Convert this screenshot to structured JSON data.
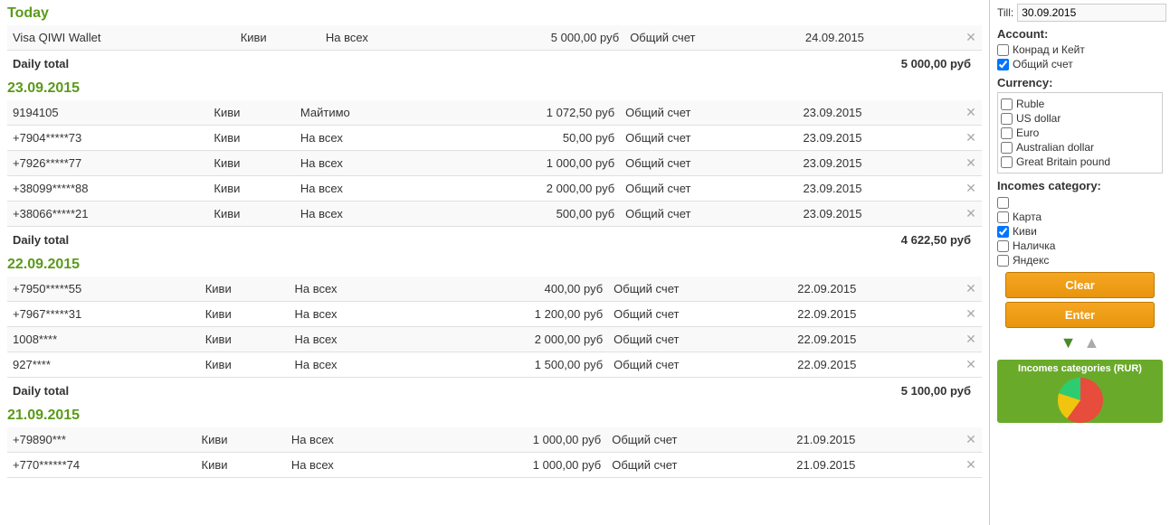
{
  "sidebar": {
    "till_label": "Till:",
    "till_date": "30.09.2015",
    "account_label": "Account:",
    "accounts": [
      {
        "id": "acc1",
        "label": "Конрад и Кейт",
        "checked": false
      },
      {
        "id": "acc2",
        "label": "Общий счет",
        "checked": true
      }
    ],
    "currency_label": "Currency:",
    "currencies": [
      {
        "id": "cur1",
        "label": "Ruble",
        "checked": false
      },
      {
        "id": "cur2",
        "label": "US dollar",
        "checked": false
      },
      {
        "id": "cur3",
        "label": "Euro",
        "checked": false
      },
      {
        "id": "cur4",
        "label": "Australian dollar",
        "checked": false
      },
      {
        "id": "cur5",
        "label": "Great Britain pound",
        "checked": false
      }
    ],
    "incomes_category_label": "Incomes category:",
    "incomes_categories": [
      {
        "id": "ic0",
        "label": "",
        "checked": false
      },
      {
        "id": "ic1",
        "label": "Карта",
        "checked": false
      },
      {
        "id": "ic2",
        "label": "Киви",
        "checked": true
      },
      {
        "id": "ic3",
        "label": "Наличка",
        "checked": false
      },
      {
        "id": "ic4",
        "label": "Яндекс",
        "checked": false
      }
    ],
    "btn_clear": "Clear",
    "btn_enter": "Enter",
    "chart_title": "Incomes categories (RUR)"
  },
  "sections": [
    {
      "date": "Today",
      "rows": [
        {
          "col1": "Visa QIWI Wallet",
          "col2": "Киви",
          "col3": "На всех",
          "amount": "5 000,00 руб",
          "account": "Общий счет",
          "date": "24.09.2015"
        }
      ],
      "daily_total_label": "Daily total",
      "daily_total_amount": "5 000,00 руб"
    },
    {
      "date": "23.09.2015",
      "rows": [
        {
          "col1": "9194105",
          "col2": "Киви",
          "col3": "Майтимо",
          "amount": "1 072,50 руб",
          "account": "Общий счет",
          "date": "23.09.2015"
        },
        {
          "col1": "+7904*****73",
          "col2": "Киви",
          "col3": "На всех",
          "amount": "50,00 руб",
          "account": "Общий счет",
          "date": "23.09.2015"
        },
        {
          "col1": "+7926*****77",
          "col2": "Киви",
          "col3": "На всех",
          "amount": "1 000,00 руб",
          "account": "Общий счет",
          "date": "23.09.2015"
        },
        {
          "col1": "+38099*****88",
          "col2": "Киви",
          "col3": "На всех",
          "amount": "2 000,00 руб",
          "account": "Общий счет",
          "date": "23.09.2015"
        },
        {
          "col1": "+38066*****21",
          "col2": "Киви",
          "col3": "На всех",
          "amount": "500,00 руб",
          "account": "Общий счет",
          "date": "23.09.2015"
        }
      ],
      "daily_total_label": "Daily total",
      "daily_total_amount": "4 622,50 руб"
    },
    {
      "date": "22.09.2015",
      "rows": [
        {
          "col1": "+7950*****55",
          "col2": "Киви",
          "col3": "На всех",
          "amount": "400,00 руб",
          "account": "Общий счет",
          "date": "22.09.2015"
        },
        {
          "col1": "+7967*****31",
          "col2": "Киви",
          "col3": "На всех",
          "amount": "1 200,00 руб",
          "account": "Общий счет",
          "date": "22.09.2015"
        },
        {
          "col1": "1008****",
          "col2": "Киви",
          "col3": "На всех",
          "amount": "2 000,00 руб",
          "account": "Общий счет",
          "date": "22.09.2015"
        },
        {
          "col1": "927****",
          "col2": "Киви",
          "col3": "На всех",
          "amount": "1 500,00 руб",
          "account": "Общий счет",
          "date": "22.09.2015"
        }
      ],
      "daily_total_label": "Daily total",
      "daily_total_amount": "5 100,00 руб"
    },
    {
      "date": "21.09.2015",
      "rows": [
        {
          "col1": "+79890***",
          "col2": "Киви",
          "col3": "На всех",
          "amount": "1 000,00 руб",
          "account": "Общий счет",
          "date": "21.09.2015"
        },
        {
          "col1": "+770******74",
          "col2": "Киви",
          "col3": "На всех",
          "amount": "1 000,00 руб",
          "account": "Общий счет",
          "date": "21.09.2015"
        }
      ],
      "daily_total_label": "",
      "daily_total_amount": ""
    }
  ]
}
